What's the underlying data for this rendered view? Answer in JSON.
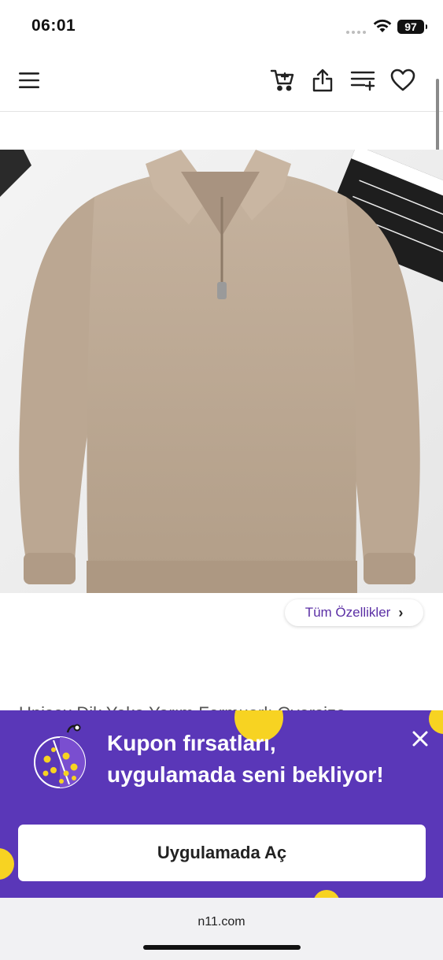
{
  "status_bar": {
    "time": "06:01",
    "battery": "97"
  },
  "header": {
    "icons": [
      "menu-icon",
      "cart-icon",
      "share-icon",
      "compare-list-icon",
      "heart-icon"
    ]
  },
  "product": {
    "image_alt": "Product image: beige half-zip sweatshirt",
    "title_partial": "Unisex Dik Yaka Yarım Fermuarlı Oversize",
    "features_label": "Tüm Özellikler"
  },
  "promo": {
    "line1": "Kupon fırsatları,",
    "line2": "uygulamada seni bekliyor!",
    "button_label": "Uygulamada Aç",
    "bg_color": "#5a37b8",
    "accent_color": "#f7d322"
  },
  "browser": {
    "url": "n11.com"
  }
}
